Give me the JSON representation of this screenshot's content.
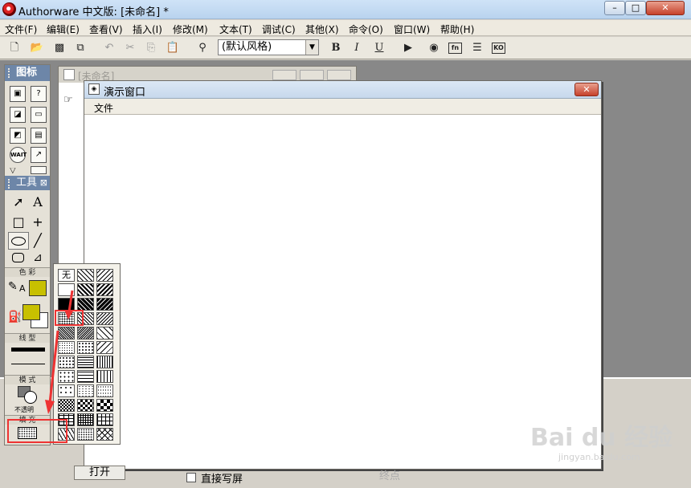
{
  "window": {
    "title": "Authorware 中文版: [未命名] *",
    "min": "–",
    "max": "□",
    "close": "✕"
  },
  "menubar": [
    "文件(F)",
    "编辑(E)",
    "查看(V)",
    "插入(I)",
    "修改(M)",
    "文本(T)",
    "调试(C)",
    "其他(X)",
    "命令(O)",
    "窗口(W)",
    "帮助(H)"
  ],
  "toolbar": {
    "style_value": "(默认风格)",
    "bold": "B",
    "italic": "I",
    "underline": "U",
    "fn_label": "fn",
    "ko_label": "KO"
  },
  "palette": {
    "icons_title": "图标",
    "tools_title": "工具",
    "tools_close": "⊠",
    "color_label": "色 彩",
    "line_label": "线 型",
    "mode_label": "模 式",
    "mode_value": "不透明",
    "fill_label": "填 充",
    "wait_label": "WAIT",
    "text_tool": "A",
    "pencil_letter": "A"
  },
  "flow_window": {
    "title": "[未命名]"
  },
  "presentation": {
    "title": "演示窗口",
    "menu_file": "文件"
  },
  "pattern_popup": {
    "none_label": "无"
  },
  "bottom": {
    "open": "打开",
    "direct_write": "直接写屏",
    "endpoint": "终点"
  },
  "watermark": {
    "brand": "Bai du 经验",
    "url": "jingyan.baidu.com"
  },
  "colors": {
    "fill_color": "#c8c000",
    "annotation": "#e33333",
    "palette_header": "#6d86a8"
  }
}
